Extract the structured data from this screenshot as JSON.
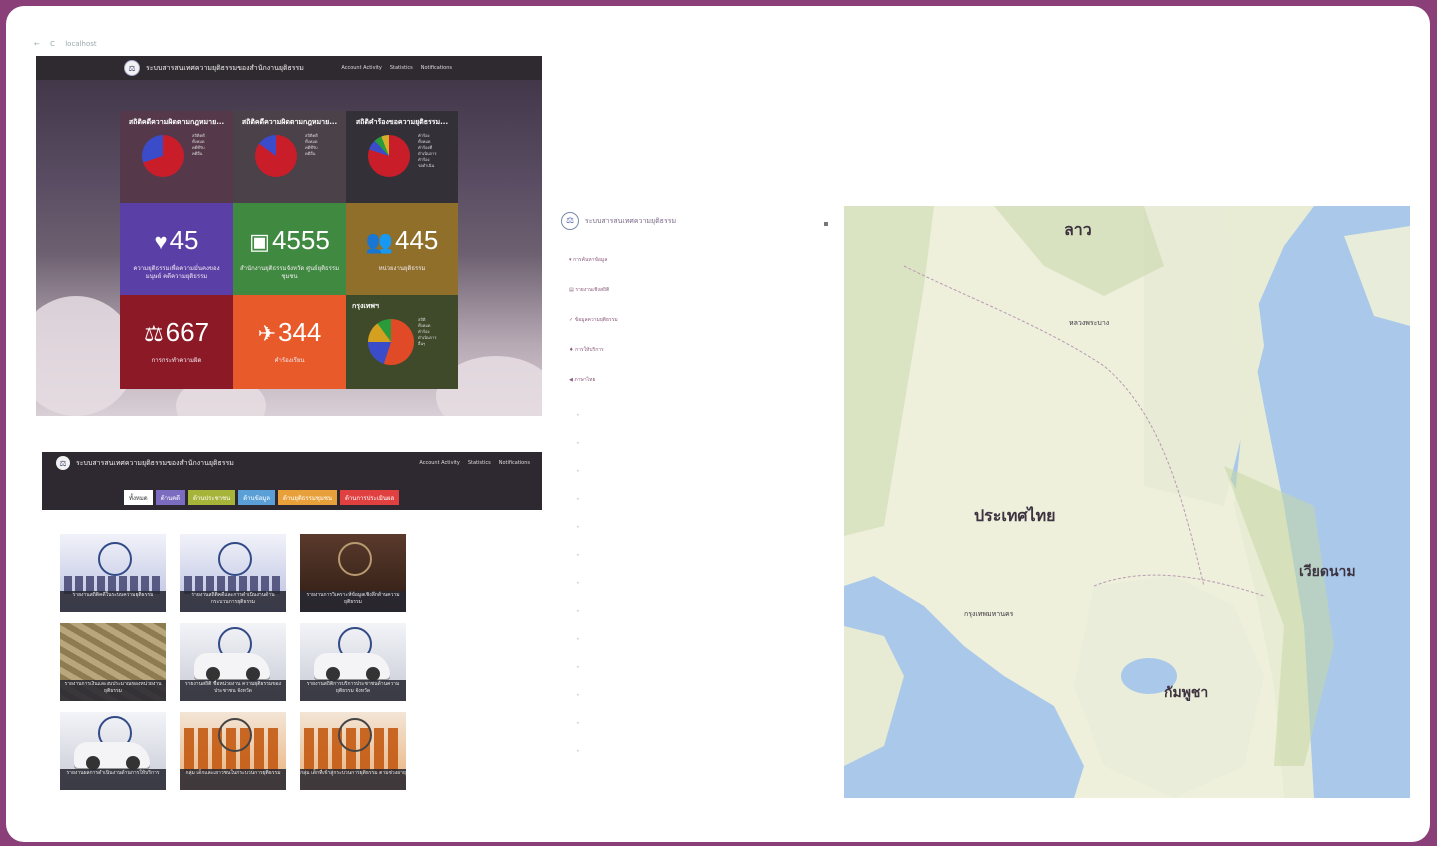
{
  "browser": {
    "back": "←",
    "reload": "C",
    "url": "localhost"
  },
  "dashboard": {
    "site_title": "ระบบสารสนเทศความยุติธรรมของสำนักงานยุติธรรม",
    "nav": [
      "Account Activity",
      "Statistics",
      "Notifications"
    ],
    "pie_tiles": [
      {
        "title": "สถิติคดีความผิดตามกฎหมาย...",
        "legend": [
          "สถิติคดี",
          "ทั้งหมด",
          "คดีที่รับ",
          "คดีอื่น"
        ],
        "colors": [
          "#c91d2a",
          "#3a4cc9"
        ],
        "shares": [
          0.7,
          0.3
        ]
      },
      {
        "title": "สถิติคดีความผิดตามกฎหมาย...",
        "legend": [
          "สถิติคดี",
          "ทั้งหมด",
          "คดีที่รับ",
          "คดีอื่น"
        ],
        "colors": [
          "#c91d2a",
          "#3a4cc9"
        ],
        "shares": [
          0.85,
          0.15
        ]
      },
      {
        "title": "สถิติคำร้องขอความยุติธรรม...",
        "legend": [
          "คำร้อง",
          "ทั้งหมด",
          "คำร้องที่",
          "ดำเนินการ",
          "คำร้อง",
          "รอดำเนิน"
        ],
        "colors": [
          "#c91d2a",
          "#3a4cc9",
          "#2a9b3a",
          "#d4b02a"
        ],
        "shares": [
          0.8,
          0.08,
          0.06,
          0.06
        ]
      }
    ],
    "stat_tiles": [
      {
        "icon": "♥",
        "value": "45",
        "caption": "ความยุติธรรมเพื่อความมั่นคงของมนุษย์ คดีความยุติธรรม",
        "color": "#5a3fa7"
      },
      {
        "icon": "▣",
        "value": "4555",
        "caption": "สำนักงานยุติธรรมจังหวัด ศูนย์ยุติธรรมชุมชน",
        "color": "#3f8a40"
      },
      {
        "icon": "👥",
        "value": "445",
        "caption": "หน่วยงานยุติธรรม",
        "color": "#8f6f2a"
      },
      {
        "icon": "⚖",
        "value": "667",
        "caption": "การกระทำความผิด",
        "color": "#8b1a26"
      },
      {
        "icon": "✈",
        "value": "344",
        "caption": "คำร้องเรียน",
        "color": "#e85a2a"
      }
    ],
    "last_tile": {
      "title": "กรุงเทพฯ",
      "legend": [
        "สถิติ",
        "ทั้งหมด",
        "คำร้อง",
        "ดำเนินการ",
        "อื่นๆ"
      ],
      "colors": [
        "#e04a26",
        "#3a4cc9",
        "#d4a020",
        "#2a9b3a"
      ],
      "shares": [
        0.55,
        0.2,
        0.15,
        0.1
      ],
      "color": "#3f4a2a"
    }
  },
  "news_page": {
    "site_title": "ระบบสารสนเทศความยุติธรรมของสำนักงานยุติธรรม",
    "nav": [
      "Account Activity",
      "Statistics",
      "Notifications"
    ],
    "tabs": [
      {
        "label": "ทั้งหมด",
        "color": "#ffffff",
        "text": "#333333"
      },
      {
        "label": "ด้านคดี",
        "color": "#7b6cc0",
        "text": "#ffffff"
      },
      {
        "label": "ด้านประชาชน",
        "color": "#a7b43a",
        "text": "#ffffff"
      },
      {
        "label": "ด้านข้อมูล",
        "color": "#5aa0d6",
        "text": "#ffffff"
      },
      {
        "label": "ด้านยุติธรรมชุมชน",
        "color": "#e8a03a",
        "text": "#ffffff"
      },
      {
        "label": "ด้านการประเมินผล",
        "color": "#e04040",
        "text": "#ffffff"
      }
    ],
    "cards": [
      {
        "style": "crowd",
        "caption": "รายงานสถิติคดีในระบบความยุติธรรม"
      },
      {
        "style": "crowd",
        "caption": "รายงานสถิติคดีและการดำเนินงานด้านกระบวนการยุติธรรม"
      },
      {
        "style": "book",
        "caption": "รายงานการวิเคราะห์ข้อมูลเชิงลึกด้านความยุติธรรม"
      },
      {
        "style": "money",
        "caption": "รายงานการเงินและงบประมาณของหน่วยงานยุติธรรม"
      },
      {
        "style": "car",
        "caption": "รายงานสถิติ ชื่อหน่วยงาน ความยุติธรรมของประชาชน จังหวัด"
      },
      {
        "style": "car",
        "caption": "รายงานสถิติการบริการประชาชนด้านความยุติธรรม จังหวัด"
      },
      {
        "style": "car",
        "caption": "รายงานผลการดำเนินงานด้านการให้บริการ"
      },
      {
        "style": "orange",
        "caption": "กลุ่ม เด็กและเยาวชนในกระบวนการยุติธรรม"
      },
      {
        "style": "orange",
        "caption": "กลุ่ม เด็กที่เข้าสู่กระบวนการยุติธรรม ตามช่วงอายุ"
      }
    ]
  },
  "side_menu": {
    "title": "ระบบสารสนเทศความยุติธรรม",
    "items": [
      "▾ การค้นหาข้อมูล",
      "▤ รายงานเชิงสถิติ",
      "✓ ข้อมูลความยุติธรรม",
      "♦ การให้บริการ",
      "◀ ภาษาไทย"
    ],
    "faint_items": [
      "▸",
      "▸",
      "▸",
      "▸",
      "▸",
      "▸",
      "▸",
      "▸",
      "▸",
      "▸",
      "▸",
      "▸",
      "▸"
    ]
  },
  "map": {
    "labels": [
      "ลาว",
      "ประเทศไทย",
      "เวียดนาม",
      "กัมพูชา",
      "กรุงเทพมหานคร",
      "หลวงพระบาง"
    ]
  }
}
